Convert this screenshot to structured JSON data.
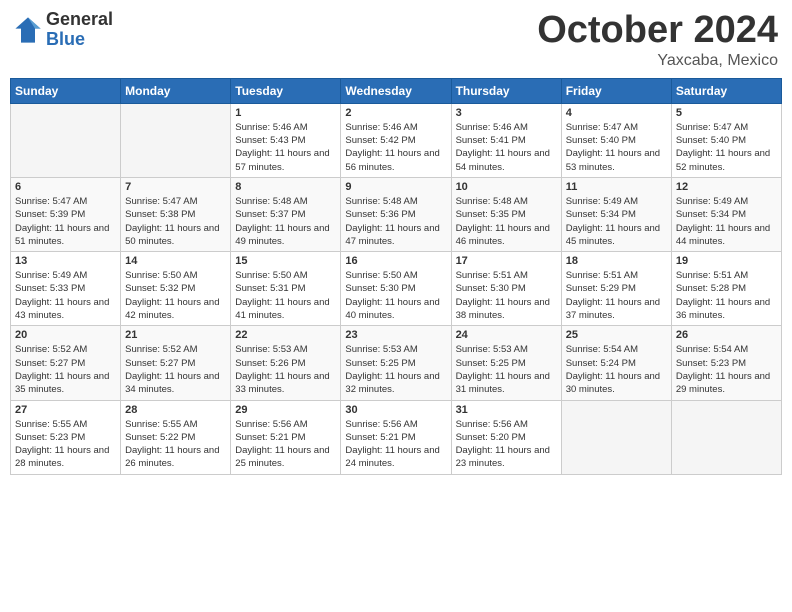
{
  "header": {
    "logo_general": "General",
    "logo_blue": "Blue",
    "month": "October 2024",
    "location": "Yaxcaba, Mexico"
  },
  "weekdays": [
    "Sunday",
    "Monday",
    "Tuesday",
    "Wednesday",
    "Thursday",
    "Friday",
    "Saturday"
  ],
  "weeks": [
    [
      {
        "day": "",
        "info": ""
      },
      {
        "day": "",
        "info": ""
      },
      {
        "day": "1",
        "info": "Sunrise: 5:46 AM\nSunset: 5:43 PM\nDaylight: 11 hours and 57 minutes."
      },
      {
        "day": "2",
        "info": "Sunrise: 5:46 AM\nSunset: 5:42 PM\nDaylight: 11 hours and 56 minutes."
      },
      {
        "day": "3",
        "info": "Sunrise: 5:46 AM\nSunset: 5:41 PM\nDaylight: 11 hours and 54 minutes."
      },
      {
        "day": "4",
        "info": "Sunrise: 5:47 AM\nSunset: 5:40 PM\nDaylight: 11 hours and 53 minutes."
      },
      {
        "day": "5",
        "info": "Sunrise: 5:47 AM\nSunset: 5:40 PM\nDaylight: 11 hours and 52 minutes."
      }
    ],
    [
      {
        "day": "6",
        "info": "Sunrise: 5:47 AM\nSunset: 5:39 PM\nDaylight: 11 hours and 51 minutes."
      },
      {
        "day": "7",
        "info": "Sunrise: 5:47 AM\nSunset: 5:38 PM\nDaylight: 11 hours and 50 minutes."
      },
      {
        "day": "8",
        "info": "Sunrise: 5:48 AM\nSunset: 5:37 PM\nDaylight: 11 hours and 49 minutes."
      },
      {
        "day": "9",
        "info": "Sunrise: 5:48 AM\nSunset: 5:36 PM\nDaylight: 11 hours and 47 minutes."
      },
      {
        "day": "10",
        "info": "Sunrise: 5:48 AM\nSunset: 5:35 PM\nDaylight: 11 hours and 46 minutes."
      },
      {
        "day": "11",
        "info": "Sunrise: 5:49 AM\nSunset: 5:34 PM\nDaylight: 11 hours and 45 minutes."
      },
      {
        "day": "12",
        "info": "Sunrise: 5:49 AM\nSunset: 5:34 PM\nDaylight: 11 hours and 44 minutes."
      }
    ],
    [
      {
        "day": "13",
        "info": "Sunrise: 5:49 AM\nSunset: 5:33 PM\nDaylight: 11 hours and 43 minutes."
      },
      {
        "day": "14",
        "info": "Sunrise: 5:50 AM\nSunset: 5:32 PM\nDaylight: 11 hours and 42 minutes."
      },
      {
        "day": "15",
        "info": "Sunrise: 5:50 AM\nSunset: 5:31 PM\nDaylight: 11 hours and 41 minutes."
      },
      {
        "day": "16",
        "info": "Sunrise: 5:50 AM\nSunset: 5:30 PM\nDaylight: 11 hours and 40 minutes."
      },
      {
        "day": "17",
        "info": "Sunrise: 5:51 AM\nSunset: 5:30 PM\nDaylight: 11 hours and 38 minutes."
      },
      {
        "day": "18",
        "info": "Sunrise: 5:51 AM\nSunset: 5:29 PM\nDaylight: 11 hours and 37 minutes."
      },
      {
        "day": "19",
        "info": "Sunrise: 5:51 AM\nSunset: 5:28 PM\nDaylight: 11 hours and 36 minutes."
      }
    ],
    [
      {
        "day": "20",
        "info": "Sunrise: 5:52 AM\nSunset: 5:27 PM\nDaylight: 11 hours and 35 minutes."
      },
      {
        "day": "21",
        "info": "Sunrise: 5:52 AM\nSunset: 5:27 PM\nDaylight: 11 hours and 34 minutes."
      },
      {
        "day": "22",
        "info": "Sunrise: 5:53 AM\nSunset: 5:26 PM\nDaylight: 11 hours and 33 minutes."
      },
      {
        "day": "23",
        "info": "Sunrise: 5:53 AM\nSunset: 5:25 PM\nDaylight: 11 hours and 32 minutes."
      },
      {
        "day": "24",
        "info": "Sunrise: 5:53 AM\nSunset: 5:25 PM\nDaylight: 11 hours and 31 minutes."
      },
      {
        "day": "25",
        "info": "Sunrise: 5:54 AM\nSunset: 5:24 PM\nDaylight: 11 hours and 30 minutes."
      },
      {
        "day": "26",
        "info": "Sunrise: 5:54 AM\nSunset: 5:23 PM\nDaylight: 11 hours and 29 minutes."
      }
    ],
    [
      {
        "day": "27",
        "info": "Sunrise: 5:55 AM\nSunset: 5:23 PM\nDaylight: 11 hours and 28 minutes."
      },
      {
        "day": "28",
        "info": "Sunrise: 5:55 AM\nSunset: 5:22 PM\nDaylight: 11 hours and 26 minutes."
      },
      {
        "day": "29",
        "info": "Sunrise: 5:56 AM\nSunset: 5:21 PM\nDaylight: 11 hours and 25 minutes."
      },
      {
        "day": "30",
        "info": "Sunrise: 5:56 AM\nSunset: 5:21 PM\nDaylight: 11 hours and 24 minutes."
      },
      {
        "day": "31",
        "info": "Sunrise: 5:56 AM\nSunset: 5:20 PM\nDaylight: 11 hours and 23 minutes."
      },
      {
        "day": "",
        "info": ""
      },
      {
        "day": "",
        "info": ""
      }
    ]
  ]
}
